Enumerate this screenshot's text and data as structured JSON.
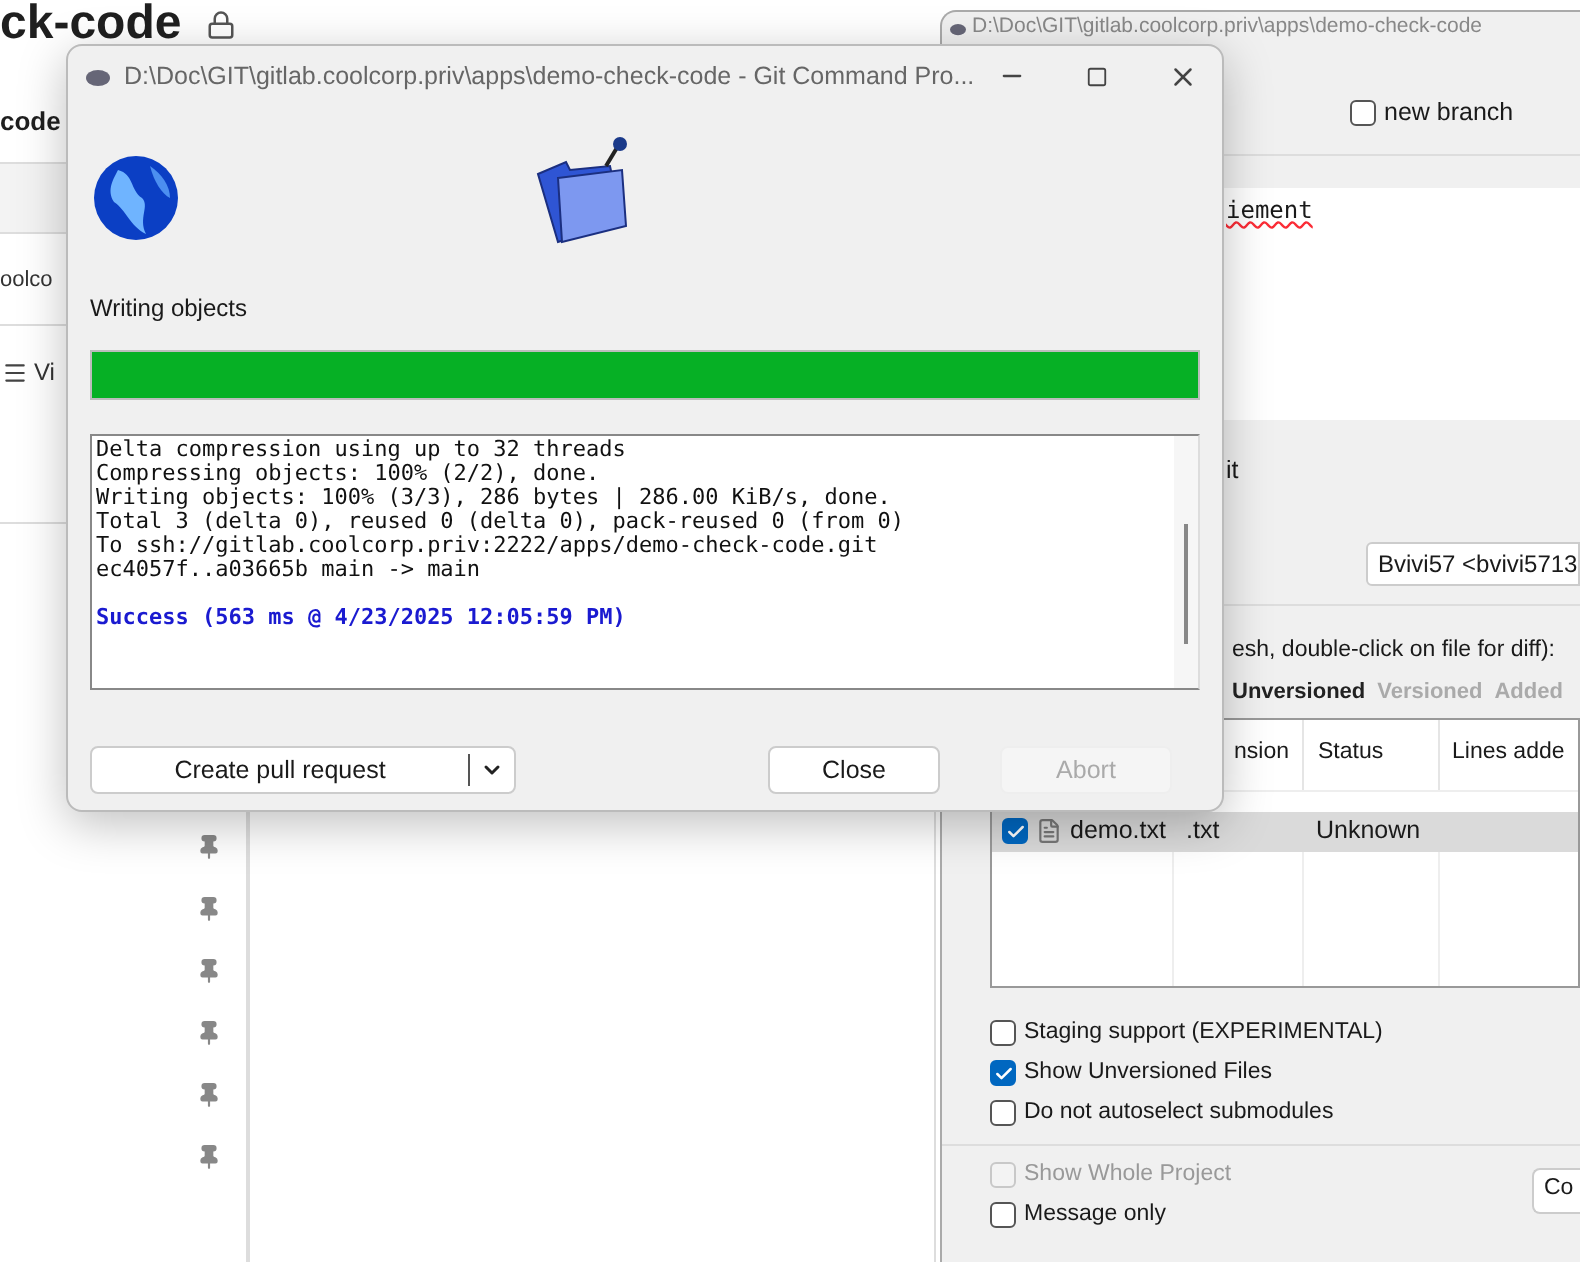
{
  "page": {
    "title": "ck-code",
    "subtitle": "code",
    "org": "oolco",
    "menu_label": "Vi"
  },
  "commit_window": {
    "title": "D:\\Doc\\GIT\\gitlab.coolcorp.priv\\apps\\demo-check-code",
    "new_branch": {
      "label": "new branch",
      "checked": false
    },
    "message": "iement",
    "section_label": "it",
    "author": "Bvivi57 <bvivi5713",
    "files_hint": "esh, double-click on file for diff):",
    "filters": [
      {
        "label": "Unversioned",
        "selected": true
      },
      {
        "label": "Versioned",
        "selected": false
      },
      {
        "label": "Added",
        "selected": false
      }
    ],
    "columns": [
      "nsion",
      "Status",
      "Lines adde"
    ],
    "rows": [
      {
        "name": "demo.txt",
        "extension": ".txt",
        "status": "Unknown",
        "checked": true,
        "selected": true
      }
    ],
    "options": [
      {
        "label": "Staging support (EXPERIMENTAL)",
        "checked": false
      },
      {
        "label": "Show Unversioned Files",
        "checked": true
      },
      {
        "label": "Do not autoselect submodules",
        "checked": false
      }
    ],
    "bottom_options": [
      {
        "label": "Show Whole Project",
        "checked": false,
        "disabled": true
      },
      {
        "label": "Message only",
        "checked": false,
        "disabled": false
      }
    ],
    "button": "Co"
  },
  "progress_dialog": {
    "title": "D:\\Doc\\GIT\\gitlab.coolcorp.priv\\apps\\demo-check-code - Git Command Pro...",
    "status": "Writing objects",
    "progress": {
      "level": 1
    },
    "log": [
      "Delta compression using up to 32 threads",
      "Compressing objects: 100% (2/2), done.",
      "Writing objects: 100% (3/3), 286 bytes | 286.00 KiB/s, done.",
      "Total 3 (delta 0), reused 0 (delta 0), pack-reused 0 (from 0)",
      "To ssh://gitlab.coolcorp.priv:2222/apps/demo-check-code.git",
      "ec4057f..a03665b  main -> main"
    ],
    "result": "Success (563 ms @ 4/23/2025 12:05:59 PM)",
    "buttons": [
      {
        "label": "Create pull request",
        "kind": "split",
        "disabled": false
      },
      {
        "label": "Close",
        "kind": "plain",
        "disabled": false
      },
      {
        "label": "Abort",
        "kind": "plain",
        "disabled": true
      }
    ]
  }
}
